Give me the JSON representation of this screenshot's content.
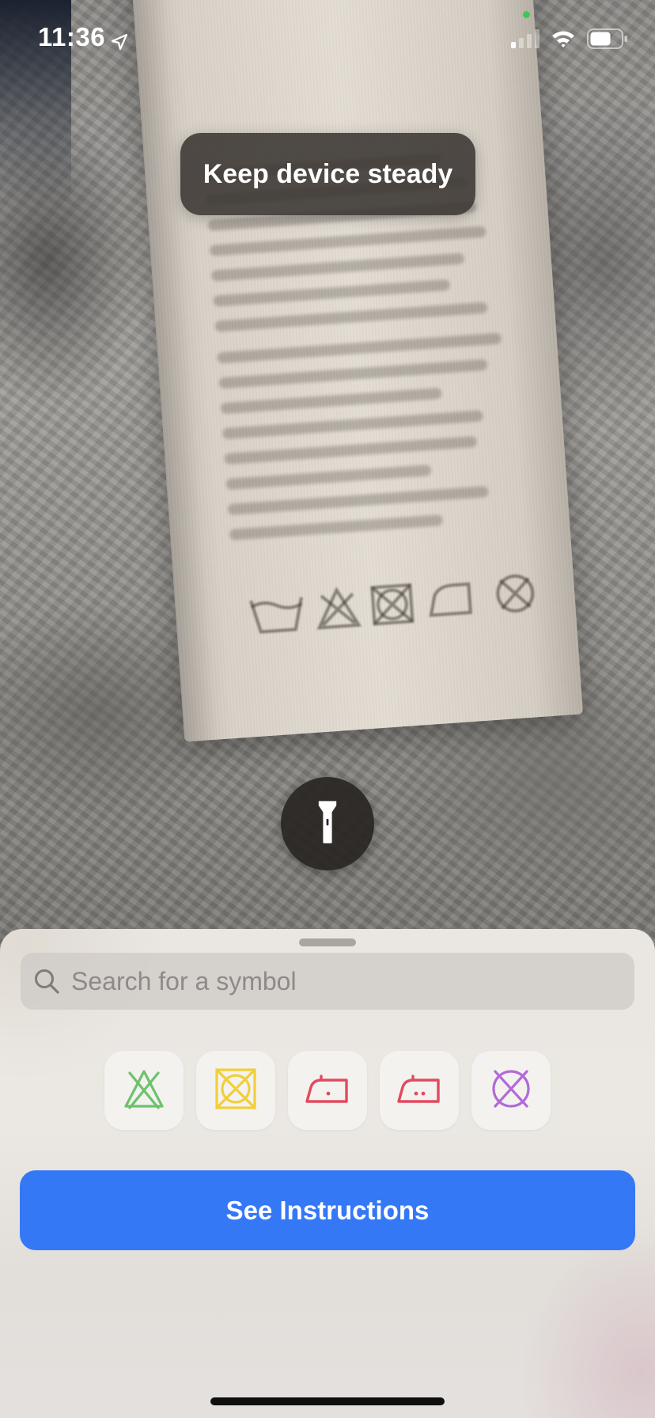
{
  "status_bar": {
    "time": "11:36",
    "location_icon": "location-arrow-icon",
    "signal_icon": "cellular-signal-icon",
    "wifi_icon": "wifi-icon",
    "battery_icon": "battery-icon",
    "battery_level": 0.6,
    "signal_bars_active": 1
  },
  "camera": {
    "hint": "Keep device steady",
    "flashlight_icon": "flashlight-icon"
  },
  "sheet": {
    "search": {
      "placeholder": "Search for a symbol",
      "value": "",
      "icon": "magnifying-glass-icon"
    },
    "symbols": [
      {
        "icon": "do-not-bleach-icon",
        "color": "#6cc26c"
      },
      {
        "icon": "do-not-tumble-dry-icon",
        "color": "#f0cf3a"
      },
      {
        "icon": "iron-low-heat-icon",
        "color": "#e24a5e"
      },
      {
        "icon": "iron-medium-heat-icon",
        "color": "#e24a5e"
      },
      {
        "icon": "do-not-dry-clean-icon",
        "color": "#b26ad8"
      }
    ],
    "primary_button": "See Instructions"
  },
  "colors": {
    "accent": "#3478f6",
    "toast_bg": "#3a3632",
    "sheet_bg": "#eae6e1"
  }
}
